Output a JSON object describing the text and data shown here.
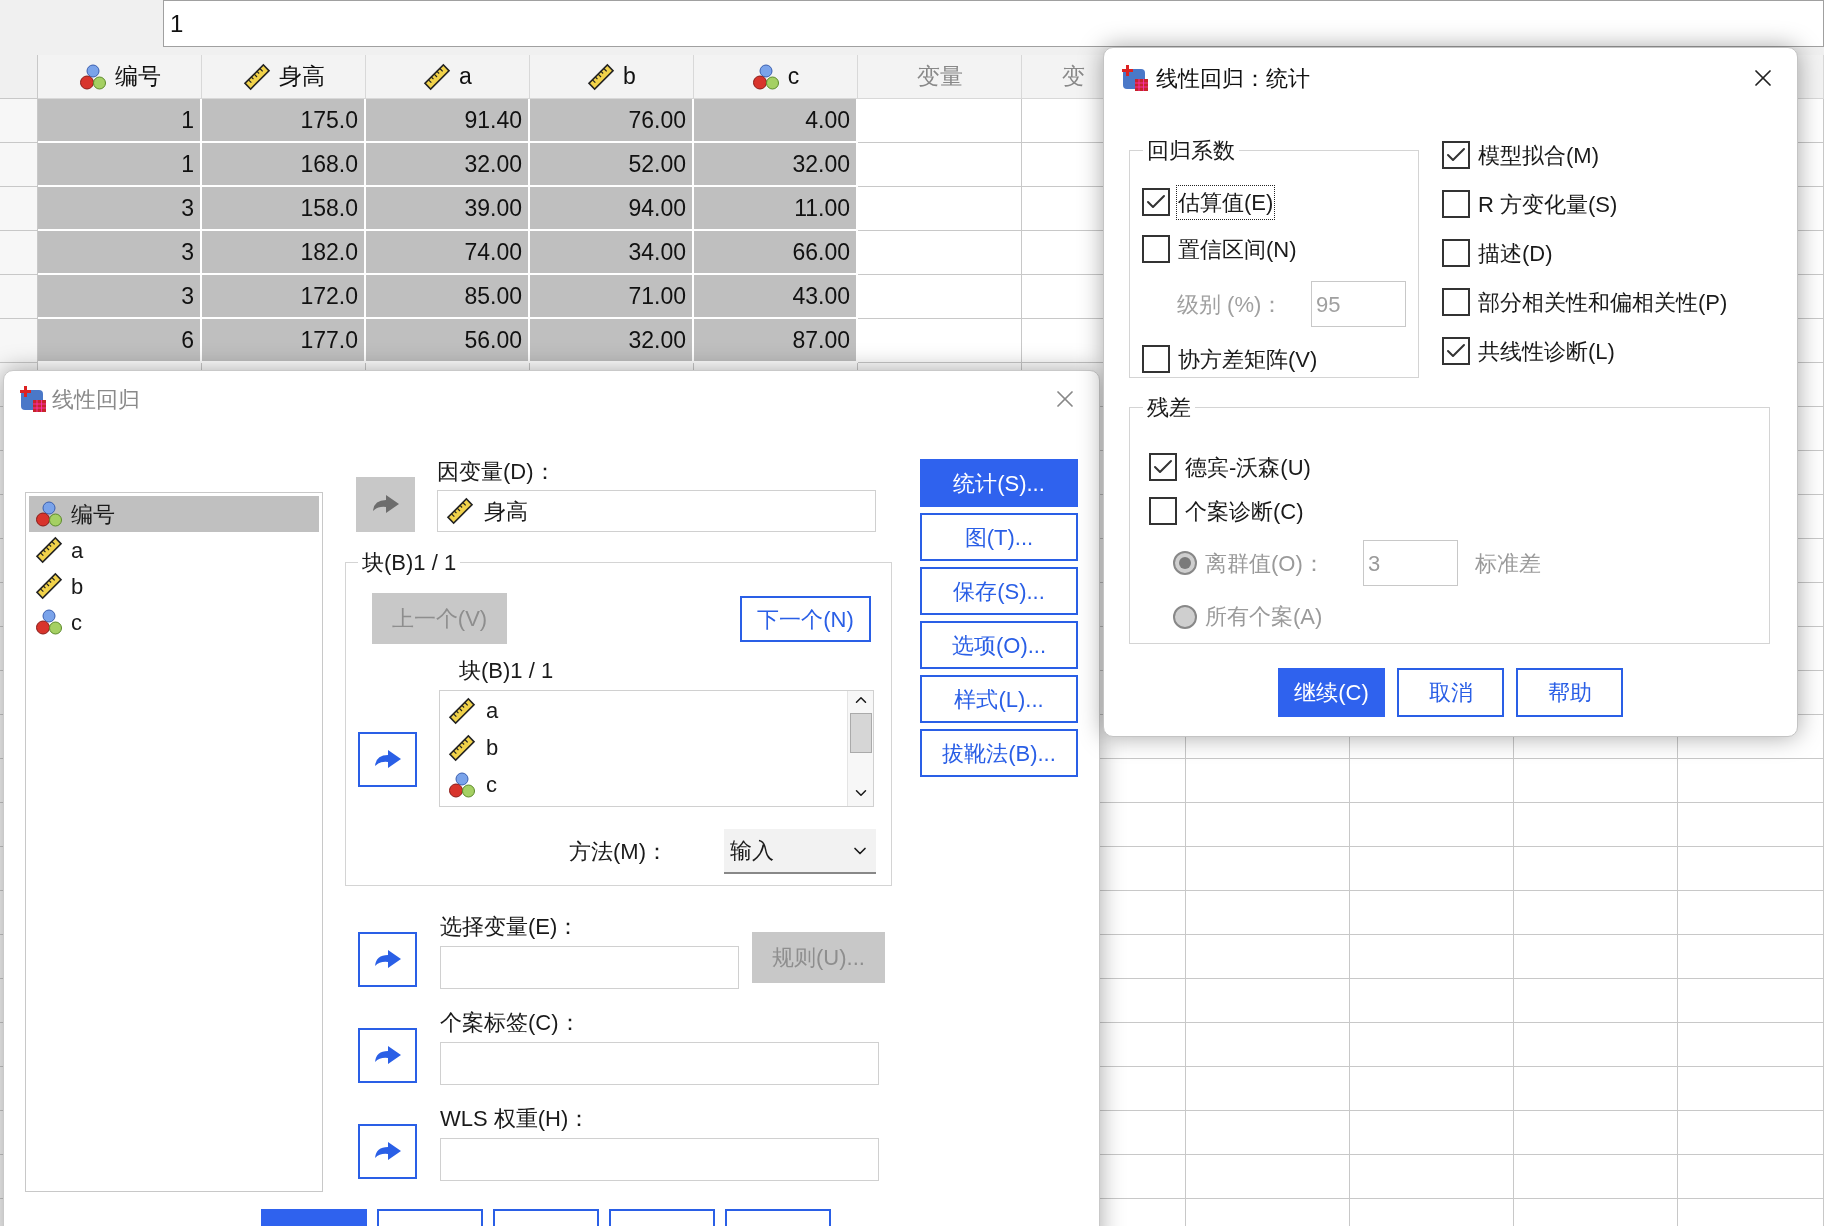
{
  "formula_bar": {
    "cell_value": "1"
  },
  "data_grid": {
    "columns": [
      {
        "label": "编号",
        "kind": "nominal"
      },
      {
        "label": "身高",
        "kind": "scale"
      },
      {
        "label": "a",
        "kind": "scale"
      },
      {
        "label": "b",
        "kind": "scale"
      },
      {
        "label": "c",
        "kind": "nominal"
      },
      {
        "label": "变量",
        "kind": "empty"
      },
      {
        "label": "变",
        "kind": "empty"
      }
    ],
    "rows": [
      {
        "cells": [
          "1",
          "175.0",
          "91.40",
          "76.00",
          "4.00"
        ],
        "selected": true
      },
      {
        "cells": [
          "1",
          "168.0",
          "32.00",
          "52.00",
          "32.00"
        ],
        "selected": true
      },
      {
        "cells": [
          "3",
          "158.0",
          "39.00",
          "94.00",
          "11.00"
        ],
        "selected": true
      },
      {
        "cells": [
          "3",
          "182.0",
          "74.00",
          "34.00",
          "66.00"
        ],
        "selected": true
      },
      {
        "cells": [
          "3",
          "172.0",
          "85.00",
          "71.00",
          "43.00"
        ],
        "selected": true
      },
      {
        "cells": [
          "6",
          "177.0",
          "56.00",
          "32.00",
          "87.00"
        ],
        "selected": true
      }
    ]
  },
  "regression_dialog": {
    "title": "线性回归",
    "active": false,
    "source_variables": [
      {
        "name": "编号",
        "kind": "nominal",
        "selected": true
      },
      {
        "name": "a",
        "kind": "scale",
        "selected": false
      },
      {
        "name": "b",
        "kind": "scale",
        "selected": false
      },
      {
        "name": "c",
        "kind": "nominal",
        "selected": false
      }
    ],
    "dependent": {
      "label": "因变量(D)：",
      "arrow_disabled": true,
      "variables": [
        {
          "name": "身高",
          "kind": "scale"
        }
      ]
    },
    "block": {
      "title": "块(B)1 / 1",
      "previous": {
        "label": "上一个(V)",
        "disabled": true
      },
      "next": {
        "label": "下一个(N)",
        "disabled": false
      },
      "list_label": "块(B)1 / 1",
      "arrow_disabled": false,
      "variables": [
        {
          "name": "a",
          "kind": "scale"
        },
        {
          "name": "b",
          "kind": "scale"
        },
        {
          "name": "c",
          "kind": "nominal"
        }
      ],
      "method_label": "方法(M)：",
      "method_value": "输入"
    },
    "selection": {
      "label": "选择变量(E)：",
      "arrow_disabled": false,
      "rule_button": {
        "label": "规则(U)...",
        "disabled": true
      }
    },
    "case_labels": {
      "label": "个案标签(C)：",
      "arrow_disabled": false
    },
    "wls": {
      "label": "WLS 权重(H)：",
      "arrow_disabled": false
    },
    "side_buttons": [
      {
        "label": "统计(S)...",
        "default": true
      },
      {
        "label": "图(T)...",
        "default": false
      },
      {
        "label": "保存(S)...",
        "default": false
      },
      {
        "label": "选项(O)...",
        "default": false
      },
      {
        "label": "样式(L)...",
        "default": false
      },
      {
        "label": "拔靴法(B)...",
        "default": false
      }
    ],
    "bottom_buttons": [
      {
        "default": true
      },
      {
        "default": false
      },
      {
        "default": false
      },
      {
        "default": false
      },
      {
        "default": false
      }
    ]
  },
  "statistics_dialog": {
    "title": "线性回归：统计",
    "active": true,
    "coefficients_group": {
      "title": "回归系数",
      "options": [
        {
          "kind": "checkbox",
          "label": "估算值(E)",
          "checked": true,
          "focused": true
        },
        {
          "kind": "checkbox",
          "label": "置信区间(N)",
          "checked": false,
          "focused": false
        },
        {
          "kind": "level_field",
          "label": "级别 (%)：",
          "value": "95",
          "disabled": true
        },
        {
          "kind": "checkbox",
          "label": "协方差矩阵(V)",
          "checked": false,
          "focused": false
        }
      ]
    },
    "model_options": [
      {
        "label": "模型拟合(M)",
        "checked": true
      },
      {
        "label": "R 方变化量(S)",
        "checked": false
      },
      {
        "label": "描述(D)",
        "checked": false
      },
      {
        "label": "部分相关性和偏相关性(P)",
        "checked": false
      },
      {
        "label": "共线性诊断(L)",
        "checked": true
      }
    ],
    "residuals_group": {
      "title": "残差",
      "options": [
        {
          "kind": "checkbox",
          "label": "德宾-沃森(U)",
          "checked": true
        },
        {
          "kind": "checkbox",
          "label": "个案诊断(C)",
          "checked": false
        },
        {
          "kind": "radio",
          "label": "离群值(O)：",
          "selected": true,
          "disabled": true,
          "value": "3",
          "unit": "标准差"
        },
        {
          "kind": "radio",
          "label": "所有个案(A)",
          "selected": false,
          "disabled": true
        }
      ]
    },
    "buttons": [
      {
        "label": "继续(C)",
        "default": true
      },
      {
        "label": "取消",
        "default": false
      },
      {
        "label": "帮助",
        "default": false
      }
    ]
  }
}
